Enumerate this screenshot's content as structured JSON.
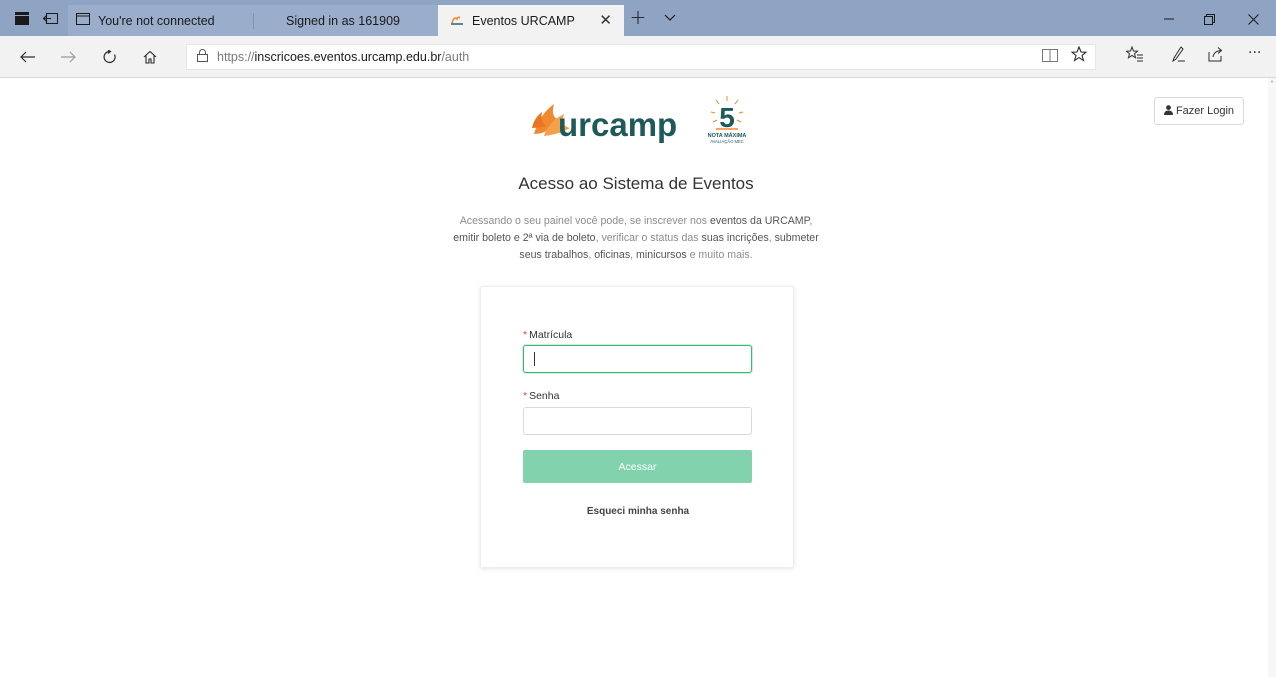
{
  "browser": {
    "tabs": [
      {
        "label": "You're not connected",
        "active": false
      },
      {
        "label": "Signed in as 161909",
        "active": false
      },
      {
        "label": "Eventos URCAMP",
        "active": true
      }
    ],
    "url": {
      "scheme": "https://",
      "host": "inscricoes.eventos.urcamp.edu.br",
      "path": "/auth"
    },
    "icons": {
      "tab_manager": "tab-manager-icon",
      "set_aside": "set-aside-tabs-icon",
      "tab_page": "page-icon",
      "new_tab": "+",
      "tab_list": "chevron-down-icon",
      "back": "back-arrow-icon",
      "forward": "forward-arrow-icon",
      "refresh": "refresh-icon",
      "home": "home-icon",
      "lock": "lock-icon",
      "reading_view": "reading-view-icon",
      "favorite": "star-icon",
      "favorites_hub": "favorites-hub-icon",
      "notes": "pen-icon",
      "share": "share-icon",
      "more": "more-icon"
    }
  },
  "header": {
    "logo_text": "urcamp",
    "logo_badge_number": "5",
    "logo_badge_caption_1": "NOTA MÁXIMA",
    "logo_badge_caption_2": "AVALIAÇÃO MEC",
    "login_label": "Fazer Login"
  },
  "main": {
    "title": "Acesso ao Sistema de Eventos",
    "description": {
      "p1": "Acessando o seu painel você pode, se inscrever nos ",
      "b1": "eventos da URCAMP",
      "p2": ", ",
      "b2": "emitir boleto e 2ª via de boleto",
      "p3": ", verificar o status das ",
      "b3": "suas incrições",
      "p4": ", ",
      "b4": "submeter seus trabalhos",
      "p5": ", ",
      "b5": "oficinas",
      "p6": ", ",
      "b6": "minicursos",
      "p7": " e muito mais."
    }
  },
  "form": {
    "matricula_label": "Matrícula",
    "matricula_value": "",
    "senha_label": "Senha",
    "senha_value": "",
    "required_mark": "*",
    "submit_label": "Acessar",
    "forgot_label": "Esqueci minha senha"
  },
  "colors": {
    "tabbar": "#8fa3c2",
    "accent_green": "#3cb878",
    "submit_disabled": "#82d3ad",
    "logo_orange": "#f0892f",
    "logo_teal": "#1e5a5a"
  }
}
